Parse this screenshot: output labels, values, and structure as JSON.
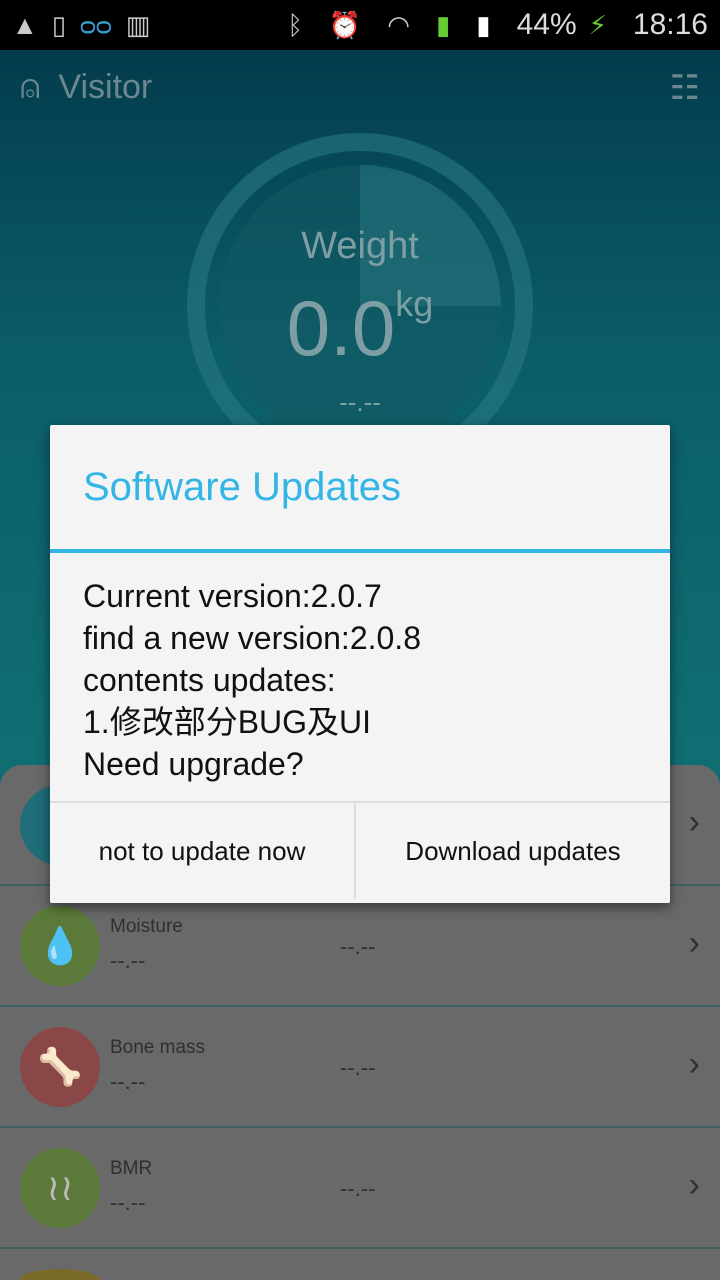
{
  "status_bar": {
    "battery": "44%",
    "time": "18:16",
    "icons": [
      "image-icon",
      "devices-icon",
      "voicemail-icon",
      "barcode-icon",
      "bluetooth-icon",
      "alarm-icon",
      "wifi-icon",
      "signal-sim1-icon",
      "signal-sim2-icon",
      "battery-charging-icon"
    ]
  },
  "header": {
    "title": "Visitor",
    "user_icon": "user-icon",
    "menu_icon": "list-icon"
  },
  "gauge": {
    "label": "Weight",
    "value": "0.0",
    "unit": "kg",
    "sub": "--.--"
  },
  "metrics": [
    {
      "name": "",
      "value": "",
      "mid": "",
      "color": "#1f6d78",
      "icon": "body-icon"
    },
    {
      "name": "Moisture",
      "value": "--.--",
      "mid": "--.--",
      "color": "#5b7a3a",
      "icon": "water-drop-icon"
    },
    {
      "name": "Bone mass",
      "value": "--.--",
      "mid": "--.--",
      "color": "#8a4747",
      "icon": "bone-icon"
    },
    {
      "name": "BMR",
      "value": "--.--",
      "mid": "--.--",
      "color": "#5b7a3a",
      "icon": "heat-icon"
    },
    {
      "name": "",
      "value": "",
      "mid": "",
      "color": "#7a6a2a",
      "icon": "metric-icon"
    }
  ],
  "dialog": {
    "title": "Software Updates",
    "lines": [
      "Current version:2.0.7",
      "find a new version:2.0.8",
      "contents updates:",
      "1.修改部分BUG及UI",
      "Need upgrade?"
    ],
    "cancel": "not to update now",
    "confirm": "Download updates",
    "accent": "#33b5e5"
  }
}
